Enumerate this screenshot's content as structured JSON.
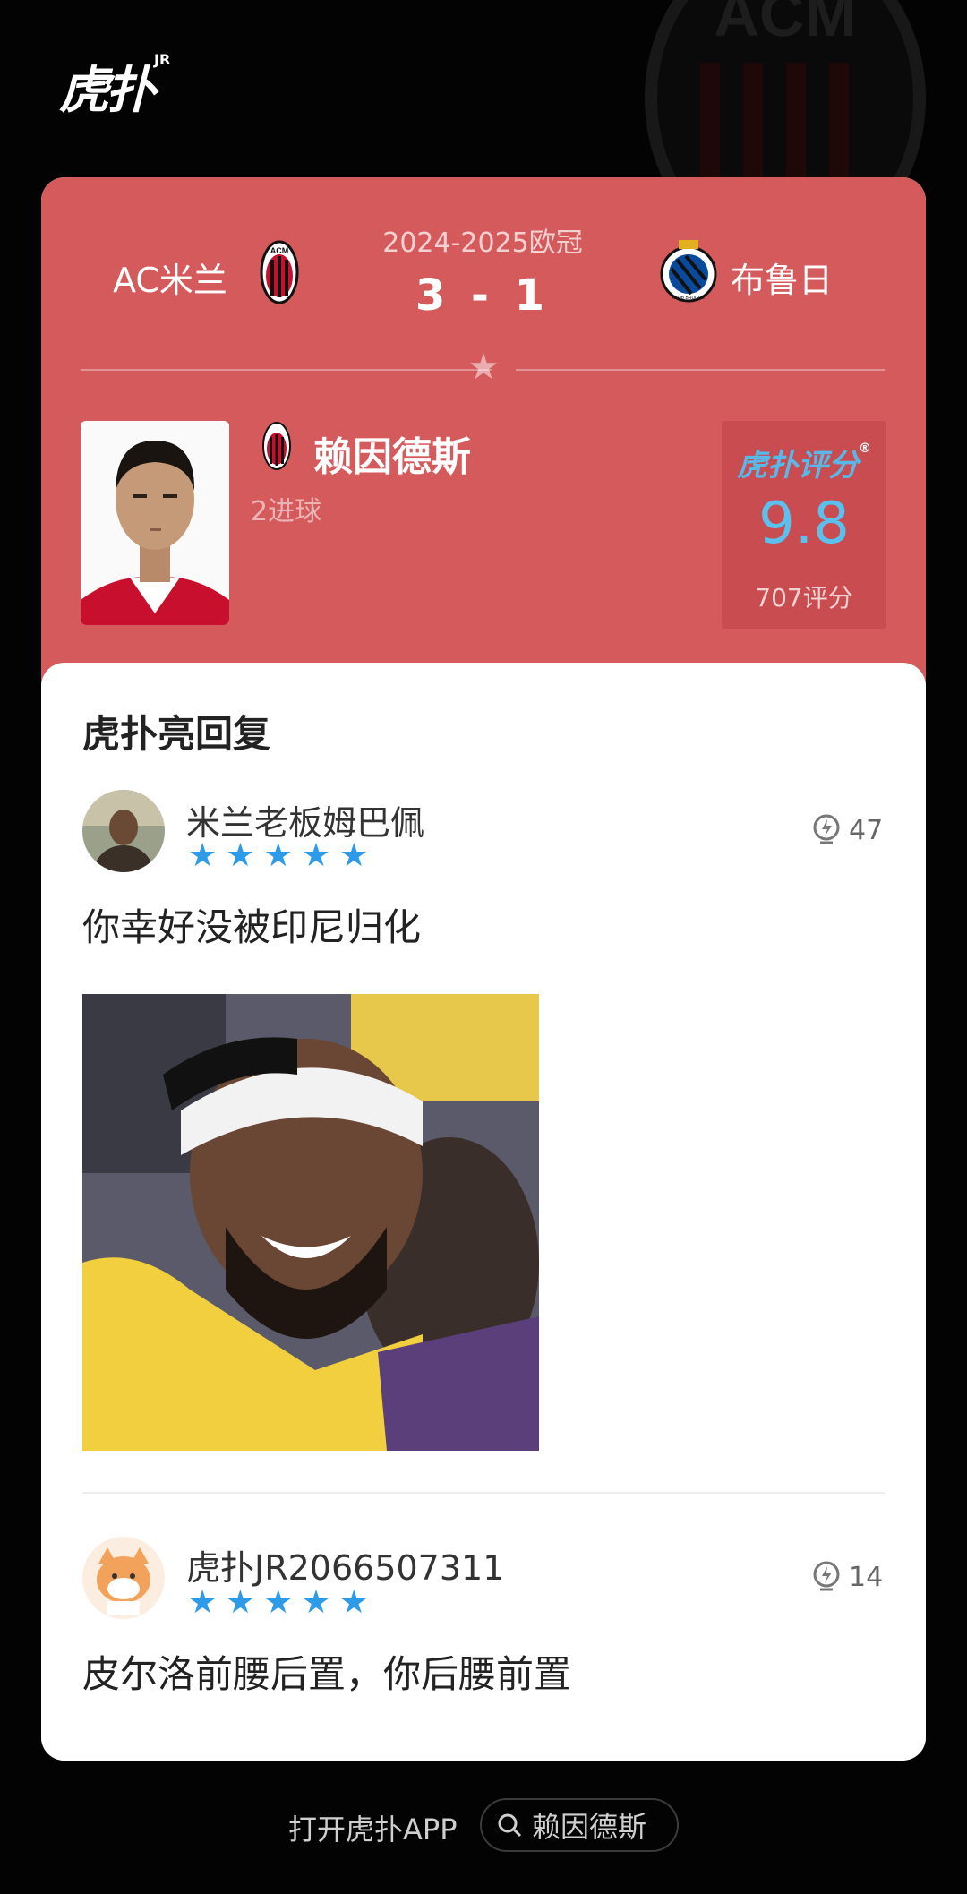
{
  "app": {
    "logo_text": "虎扑",
    "logo_sup": "JR"
  },
  "match": {
    "home_team": "AC米兰",
    "away_team": "布鲁日",
    "competition": "2024-2025欧冠",
    "score": "3 - 1",
    "home_crest_text": "ACM",
    "away_crest_text": "CLUB BRUGGE"
  },
  "player": {
    "name": "赖因德斯",
    "stat": "2进球"
  },
  "rating": {
    "label": "虎扑评分",
    "registered_mark": "®",
    "value": "9.8",
    "count": "707评分"
  },
  "replies": {
    "title": "虎扑亮回复",
    "items": [
      {
        "user": "米兰老板姆巴佩",
        "stars": 5,
        "likes": "47",
        "text": "你幸好没被印尼归化",
        "has_image": true
      },
      {
        "user": "虎扑JR2066507311",
        "stars": 5,
        "likes": "14",
        "text": "皮尔洛前腰后置，你后腰前置",
        "has_image": false
      }
    ]
  },
  "footer": {
    "open_app": "打开虎扑APP",
    "search_query": "赖因德斯"
  },
  "colors": {
    "card_red": "#d45a5c",
    "rating_blue": "#5cc0ef",
    "star_blue": "#2e9be8"
  }
}
